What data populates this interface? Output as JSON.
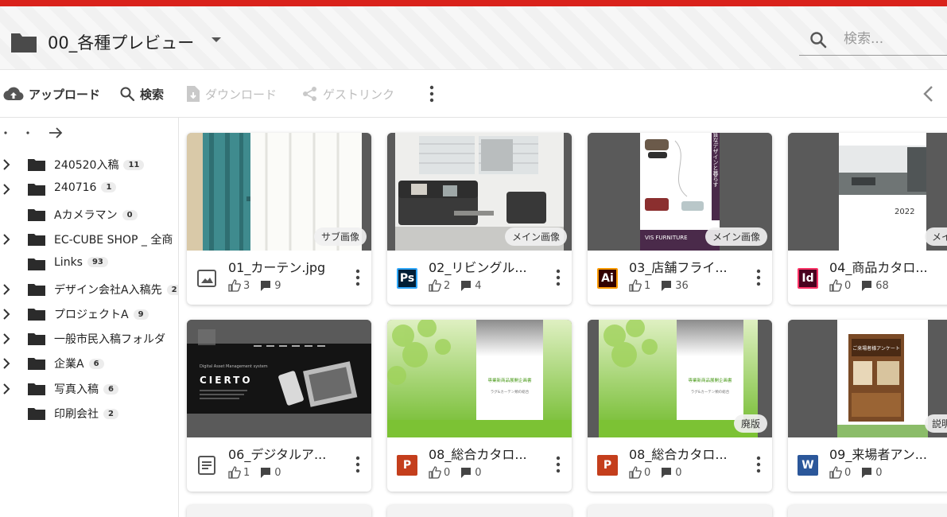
{
  "header": {
    "title": "00_各種プレビュー",
    "search_placeholder": "検索..."
  },
  "toolbar": {
    "upload": "アップロード",
    "search": "検索",
    "download": "ダウンロード",
    "guest_link": "ゲストリンク"
  },
  "sidebar": {
    "items": [
      {
        "label": "240520入稿",
        "count": "11",
        "expandable": true
      },
      {
        "label": "240716",
        "count": "1",
        "expandable": true
      },
      {
        "label": "Aカメラマン",
        "count": "0",
        "expandable": false
      },
      {
        "label": "EC-CUBE SHOP _ 全商",
        "count": "",
        "expandable": true
      },
      {
        "label": "Links",
        "count": "93",
        "expandable": false
      },
      {
        "label": "デザイン会社A入稿先",
        "count": "2",
        "expandable": true
      },
      {
        "label": "プロジェクトA",
        "count": "9",
        "expandable": true
      },
      {
        "label": "一般市民入稿フォルダ",
        "count": "",
        "expandable": true
      },
      {
        "label": "企業A",
        "count": "6",
        "expandable": true
      },
      {
        "label": "写真入稿",
        "count": "6",
        "expandable": true
      },
      {
        "label": "印刷会社",
        "count": "2",
        "expandable": false
      }
    ]
  },
  "files": [
    {
      "name": "01_カーテン.jpg",
      "likes": "3",
      "comments": "9",
      "tag": "サブ画像",
      "type": "image",
      "icon": "image-icon"
    },
    {
      "name": "02_リビングル...",
      "likes": "2",
      "comments": "4",
      "tag": "メイン画像",
      "type": "ps",
      "badge": "Ps",
      "color": "#001e36",
      "accent": "#31a8ff"
    },
    {
      "name": "03_店舗フライ...",
      "likes": "1",
      "comments": "36",
      "tag": "メイン画像",
      "type": "ai",
      "badge": "Ai",
      "color": "#330000",
      "accent": "#ff9a00"
    },
    {
      "name": "04_商品カタロ...",
      "likes": "0",
      "comments": "68",
      "tag": "メイン",
      "type": "id",
      "badge": "Id",
      "color": "#49021f",
      "accent": "#ff3366"
    },
    {
      "name": "06_デジタルア...",
      "likes": "1",
      "comments": "0",
      "tag": "",
      "type": "doc",
      "icon": "document-icon"
    },
    {
      "name": "08_総合カタロ...",
      "likes": "0",
      "comments": "0",
      "tag": "",
      "type": "pp",
      "badge": "P",
      "color": "#c43e1c"
    },
    {
      "name": "08_総合カタロ...",
      "likes": "0",
      "comments": "0",
      "tag": "廃版",
      "type": "pp",
      "badge": "P",
      "color": "#c43e1c"
    },
    {
      "name": "09_来場者アン...",
      "likes": "0",
      "comments": "0",
      "tag": "説明資",
      "type": "word",
      "badge": "W",
      "color": "#2b579a"
    }
  ],
  "thumbnail_text": {
    "cierto": "CIERTO",
    "cierto_sub": "Digital Asset Management system",
    "furniture_brand": "VIS FURNITURE",
    "furniture_tagline": "上質なデザインと暮らす",
    "catalog_year": "2022",
    "green_title": "専業新商品展開企画書",
    "green_sub": "ラグ&カーテン類の総合",
    "word_title": "ご来場者様アンケート"
  }
}
